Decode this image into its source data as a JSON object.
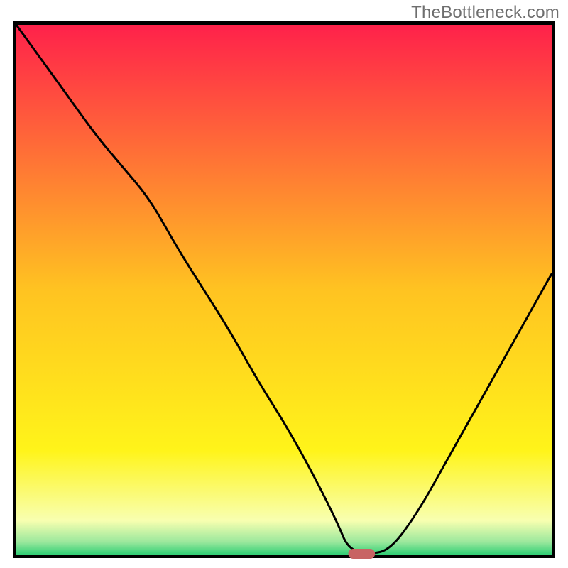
{
  "watermark": "TheBottleneck.com",
  "chart_data": {
    "type": "line",
    "title": "",
    "xlabel": "",
    "ylabel": "",
    "xlim": [
      0,
      100
    ],
    "ylim": [
      0,
      100
    ],
    "grid": false,
    "series": [
      {
        "name": "curve",
        "x": [
          0,
          5,
          10,
          15,
          20,
          25,
          30,
          35,
          40,
          45,
          50,
          55,
          60,
          62,
          66,
          70,
          75,
          80,
          85,
          90,
          95,
          100
        ],
        "y": [
          100,
          93,
          86,
          79,
          73,
          67,
          58,
          50,
          42,
          33,
          25,
          16,
          6,
          1,
          0,
          1,
          8,
          17,
          26,
          35,
          44,
          53
        ]
      }
    ],
    "marker": {
      "x_range": [
        62,
        67
      ],
      "y": 0,
      "color": "#c86464"
    },
    "gradient_stops": [
      {
        "offset": 0.0,
        "color": "#ff1f4b"
      },
      {
        "offset": 0.5,
        "color": "#ffc321"
      },
      {
        "offset": 0.8,
        "color": "#fff41a"
      },
      {
        "offset": 0.93,
        "color": "#f8ffb0"
      },
      {
        "offset": 0.97,
        "color": "#9be89d"
      },
      {
        "offset": 1.0,
        "color": "#14c86a"
      }
    ],
    "border_color": "#000000",
    "border_width": 5,
    "curve_color": "#000000",
    "curve_width": 3
  }
}
